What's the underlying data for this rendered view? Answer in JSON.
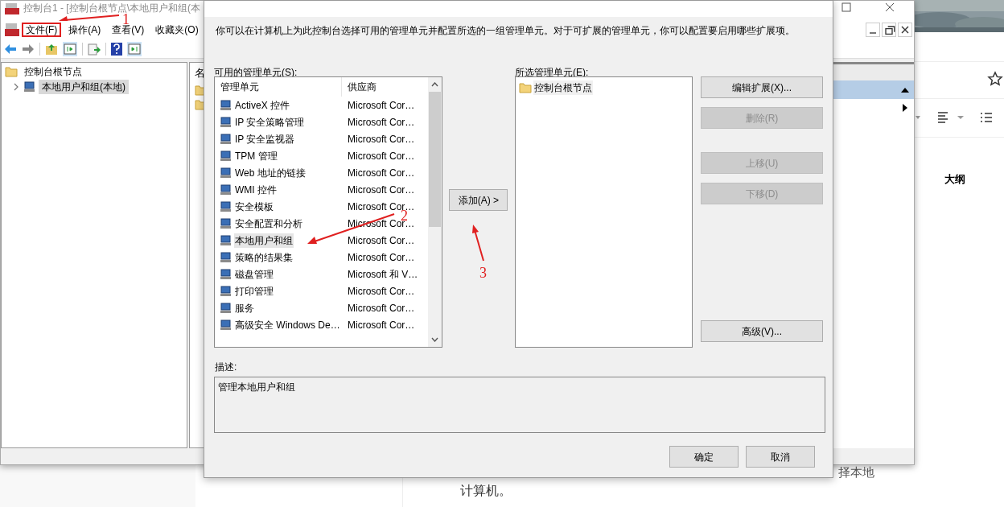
{
  "background_page": {
    "outline_title": "大纲",
    "body_text": "计算机。",
    "side_text": "择本地"
  },
  "mmc_window": {
    "title": "控制台1 - [控制台根节点\\本地用户和组(本",
    "menu": [
      {
        "label": "文件(F)",
        "highlighted": true
      },
      {
        "label": "操作(A)",
        "highlighted": false
      },
      {
        "label": "查看(V)",
        "highlighted": false
      },
      {
        "label": "收藏夹(O)",
        "highlighted": false
      }
    ],
    "tree": [
      {
        "label": "控制台根节点",
        "selected": false,
        "children": [
          {
            "label": "本地用户和组(本地)",
            "selected": true,
            "expanded": false
          }
        ]
      }
    ],
    "column_header": "名"
  },
  "dialog": {
    "intro": "你可以在计算机上为此控制台选择可用的管理单元并配置所选的一组管理单元。对于可扩展的管理单元，你可以配置要启用哪些扩展项。",
    "available_label": "可用的管理单元(S):",
    "columns": [
      "管理单元",
      "供应商"
    ],
    "snapins": [
      {
        "name": "ActiveX 控件",
        "vendor": "Microsoft Cor…",
        "selected": false
      },
      {
        "name": "IP 安全策略管理",
        "vendor": "Microsoft Cor…",
        "selected": false
      },
      {
        "name": "IP 安全监视器",
        "vendor": "Microsoft Cor…",
        "selected": false
      },
      {
        "name": "TPM 管理",
        "vendor": "Microsoft Cor…",
        "selected": false
      },
      {
        "name": "Web 地址的链接",
        "vendor": "Microsoft Cor…",
        "selected": false
      },
      {
        "name": "WMI 控件",
        "vendor": "Microsoft Cor…",
        "selected": false
      },
      {
        "name": "安全模板",
        "vendor": "Microsoft Cor…",
        "selected": false
      },
      {
        "name": "安全配置和分析",
        "vendor": "Microsoft Cor…",
        "selected": false
      },
      {
        "name": "本地用户和组",
        "vendor": "Microsoft Cor…",
        "selected": true
      },
      {
        "name": "策略的结果集",
        "vendor": "Microsoft Cor…",
        "selected": false
      },
      {
        "name": "磁盘管理",
        "vendor": "Microsoft 和 V…",
        "selected": false
      },
      {
        "name": "打印管理",
        "vendor": "Microsoft Cor…",
        "selected": false
      },
      {
        "name": "服务",
        "vendor": "Microsoft Cor…",
        "selected": false
      },
      {
        "name": "高级安全 Windows De…",
        "vendor": "Microsoft Cor…",
        "selected": false
      }
    ],
    "add_button": "添加(A) >",
    "selected_label": "所选管理单元(E):",
    "selected_snapins": [
      {
        "name": "控制台根节点"
      }
    ],
    "side_buttons": [
      {
        "label": "编辑扩展(X)...",
        "disabled": false
      },
      {
        "label": "删除(R)",
        "disabled": true
      },
      {
        "label": "上移(U)",
        "disabled": true
      },
      {
        "label": "下移(D)",
        "disabled": true
      }
    ],
    "advanced_button": "高级(V)...",
    "description_label": "描述:",
    "description": "管理本地用户和组",
    "buttons": [
      "确定",
      "取消"
    ]
  },
  "annotations": [
    {
      "label": "1"
    },
    {
      "label": "2"
    },
    {
      "label": "3"
    }
  ]
}
